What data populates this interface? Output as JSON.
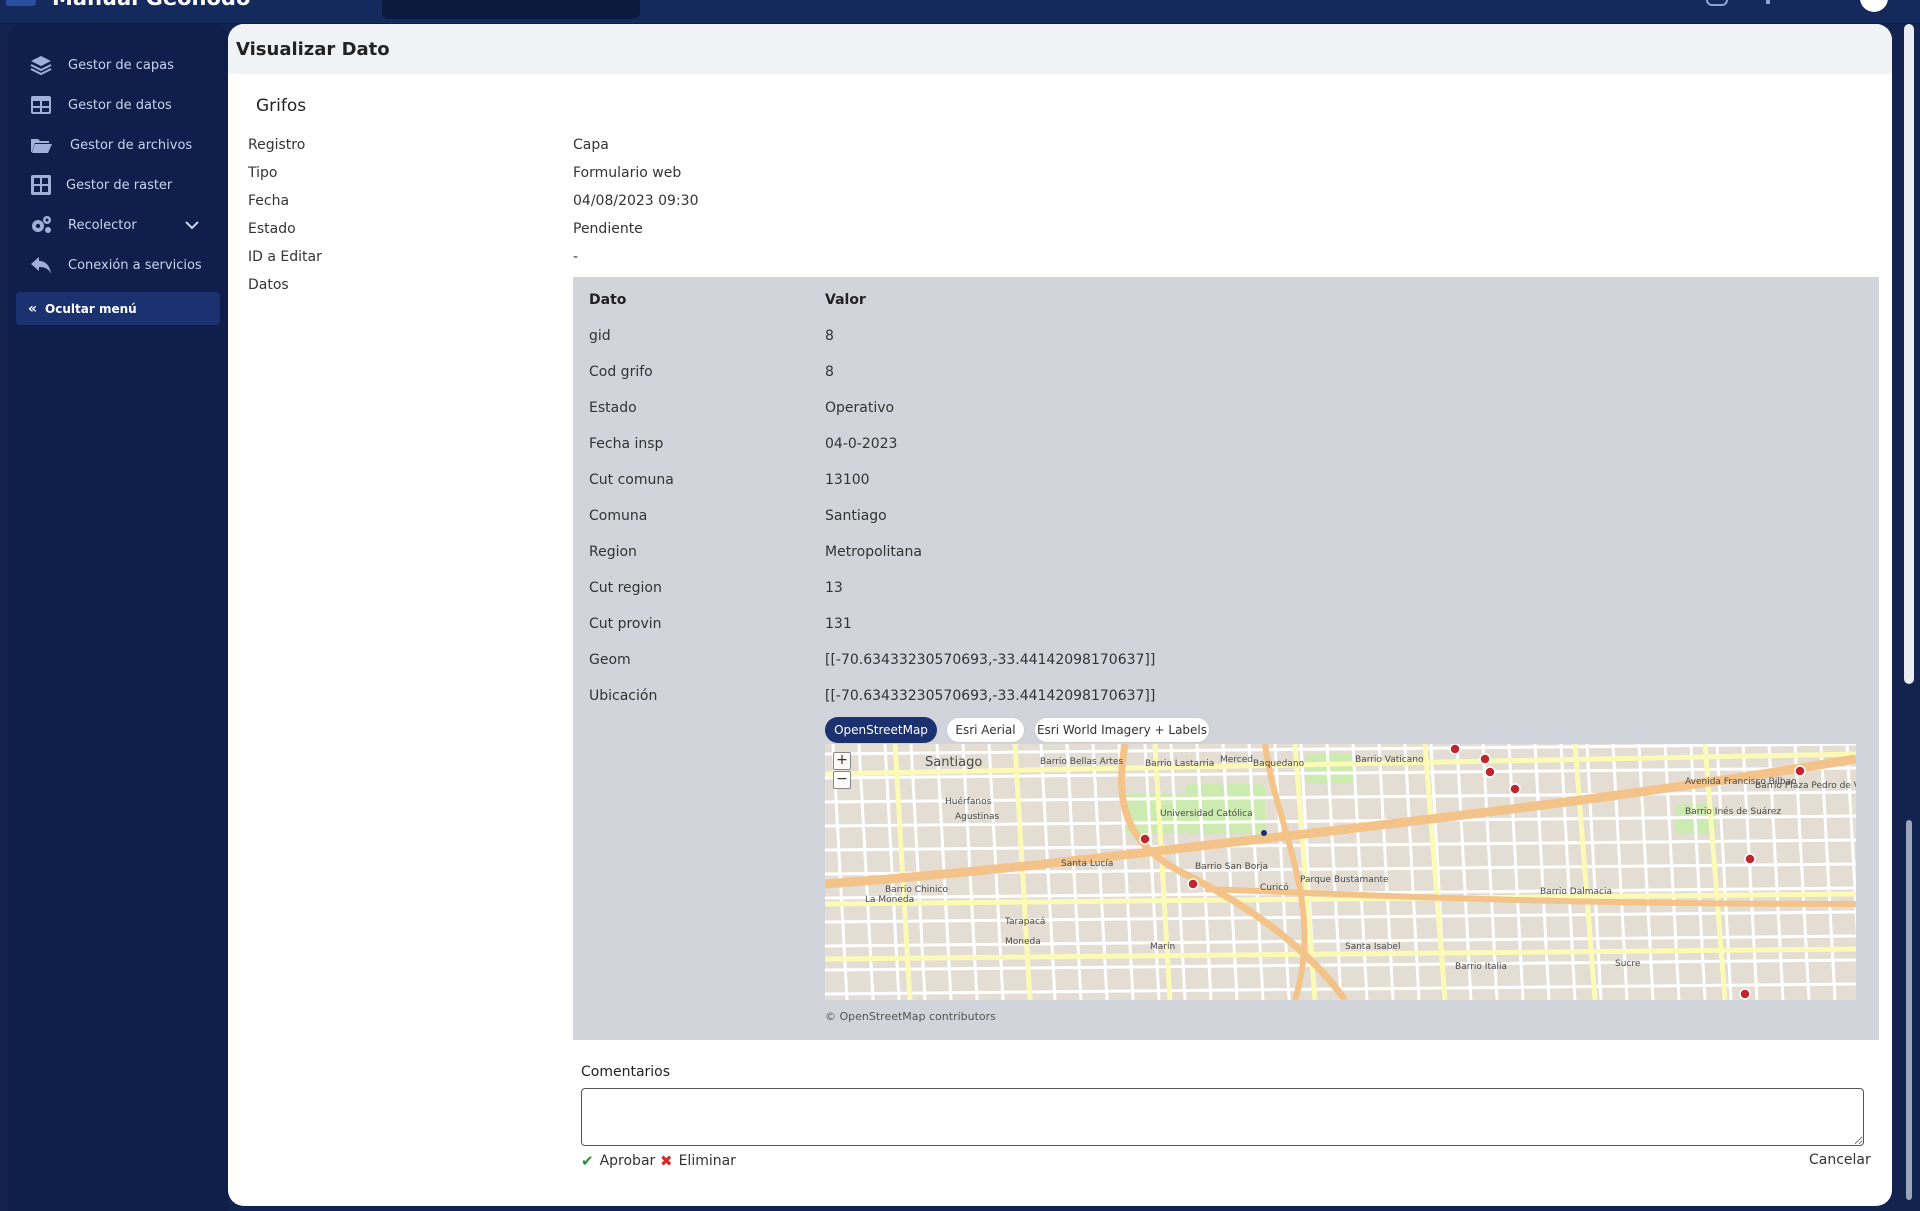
{
  "app": {
    "title": "Manual Geonodo"
  },
  "sidebar": {
    "items": [
      {
        "label": "Gestor de capas",
        "icon": "layers-icon"
      },
      {
        "label": "Gestor de datos",
        "icon": "table-icon"
      },
      {
        "label": "Gestor de archivos",
        "icon": "folder-icon"
      },
      {
        "label": "Gestor de raster",
        "icon": "grid-icon"
      },
      {
        "label": "Recolector",
        "icon": "gears-icon"
      },
      {
        "label": "Conexión a servicios",
        "icon": "reply-arrow-icon"
      }
    ],
    "hide_menu_label": "Ocultar menú"
  },
  "page": {
    "title": "Visualizar Dato",
    "layer_name": "Grifos"
  },
  "info": {
    "registro_label": "Registro",
    "registro_value": "Capa",
    "tipo_label": "Tipo",
    "tipo_value": "Formulario web",
    "fecha_label": "Fecha",
    "fecha_value": "04/08/2023 09:30",
    "estado_label": "Estado",
    "estado_value": "Pendiente",
    "id_editar_label": "ID a Editar",
    "id_editar_value": "-",
    "datos_label": "Datos"
  },
  "data_table": {
    "col_dato": "Dato",
    "col_valor": "Valor",
    "rows": [
      {
        "key": "gid",
        "value": "8"
      },
      {
        "key": "Cod grifo",
        "value": "8"
      },
      {
        "key": "Estado",
        "value": "Operativo"
      },
      {
        "key": "Fecha insp",
        "value": "04-0-2023"
      },
      {
        "key": "Cut comuna",
        "value": "13100"
      },
      {
        "key": "Comuna",
        "value": "Santiago"
      },
      {
        "key": "Region",
        "value": "Metropolitana"
      },
      {
        "key": "Cut region",
        "value": "13"
      },
      {
        "key": "Cut provin",
        "value": "131"
      },
      {
        "key": "Geom",
        "value": "[[-70.63433230570693,-33.44142098170637]]"
      },
      {
        "key": "Ubicación",
        "value": "[[-70.63433230570693,-33.44142098170637]]"
      }
    ]
  },
  "map": {
    "layers": [
      "OpenStreetMap",
      "Esri Aerial",
      "Esri World Imagery + Labels"
    ],
    "active_layer": "OpenStreetMap",
    "zoom_in": "+",
    "zoom_out": "−",
    "attribution": "© OpenStreetMap contributors",
    "labels": [
      "Santiago",
      "Barrio Bellas Artes",
      "Barrio Lastarria",
      "Baquedano",
      "Barrio Vaticano",
      "Barrio Plaza Pedro de Valdivia",
      "Barrio Inés de Suárez",
      "Universidad Católica",
      "Santa Lucía",
      "Parque Bustamante",
      "La Moneda",
      "Barrio Chinico",
      "Barrio Dalmacia",
      "Santa Isabel",
      "Barrio Italia",
      "Barrio San Borja",
      "Avenida Francisco Bilbao",
      "Agustinas",
      "Huérfanos",
      "Merced",
      "Moneda",
      "Curicó",
      "Marín",
      "Sucre",
      "Tarapacá"
    ],
    "colors": {
      "land": "#e3ddd3",
      "major_road": "#f4c38a",
      "minor_road": "#fbfab7",
      "street": "#ffffff",
      "park": "#cdebb0",
      "poi": "#c0262d"
    }
  },
  "comments": {
    "label": "Comentarios",
    "value": ""
  },
  "actions": {
    "approve": "Aprobar",
    "delete": "Eliminar",
    "cancel": "Cancelar"
  },
  "colors": {
    "sidebar_bg": "#0f1e4a",
    "accent": "#1b3170",
    "approve": "#2e8b3e",
    "delete": "#d42a2a",
    "panel": "#d1d4db"
  }
}
